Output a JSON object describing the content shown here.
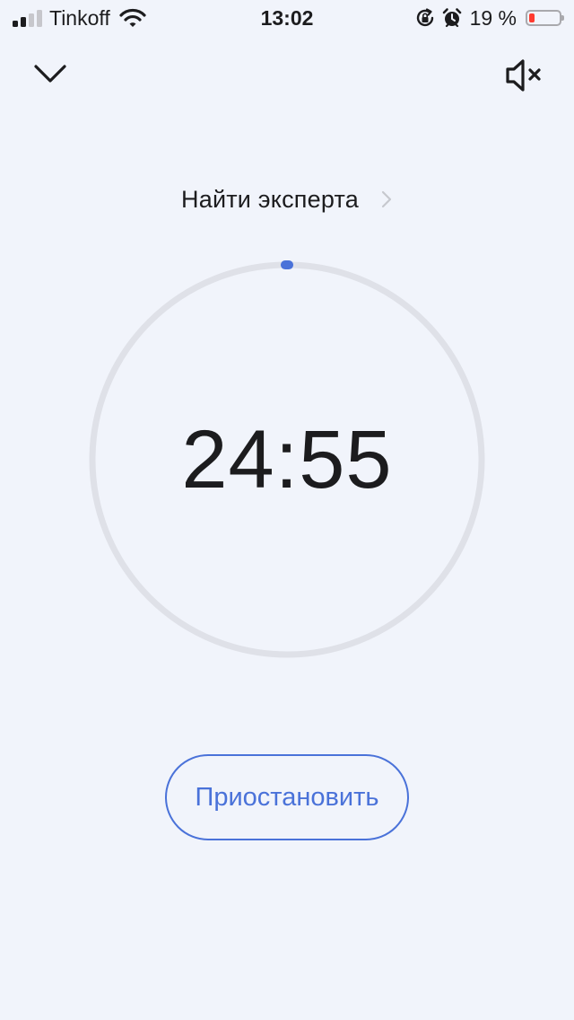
{
  "status_bar": {
    "carrier": "Tinkoff",
    "time": "13:02",
    "battery_percent": "19 %",
    "battery_color": "#ff3b30",
    "icons": [
      "signal-icon",
      "wifi-icon",
      "orientation-lock-icon",
      "alarm-icon",
      "battery-icon"
    ]
  },
  "toolbar": {
    "collapse_icon": "chevron-down-icon",
    "mute_icon": "speaker-muted-icon"
  },
  "expert_link": {
    "label": "Найти эксперта",
    "icon": "chevron-right-icon"
  },
  "timer": {
    "time": "24:55",
    "progress_fraction": 0.003,
    "ring_color": "#dfe1e8",
    "progress_color": "#4a72d9"
  },
  "actions": {
    "pause_label": "Приостановить",
    "accent_color": "#4a72d9"
  }
}
